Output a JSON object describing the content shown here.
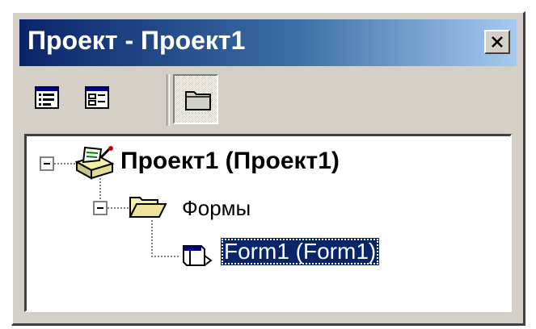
{
  "window": {
    "title": "Проект - Проект1",
    "close_icon": "close-x-icon"
  },
  "toolbar": {
    "buttons": [
      {
        "icon": "view-code-icon",
        "pressed": false
      },
      {
        "icon": "view-object-icon",
        "pressed": false
      },
      {
        "icon": "toggle-folders-icon",
        "pressed": true
      }
    ]
  },
  "tree": {
    "root": {
      "label": "Проект1 (Проект1)",
      "icon": "project-icon",
      "expanded": true
    },
    "folder": {
      "label": "Формы",
      "icon": "open-folder-icon",
      "expanded": true
    },
    "item": {
      "label": "Form1 (Form1)",
      "icon": "form-icon",
      "selected": true
    }
  },
  "colors": {
    "titlebar_start": "#0a246a",
    "titlebar_end": "#a6caf0",
    "face": "#d4d0c8",
    "selection": "#0a246a"
  }
}
